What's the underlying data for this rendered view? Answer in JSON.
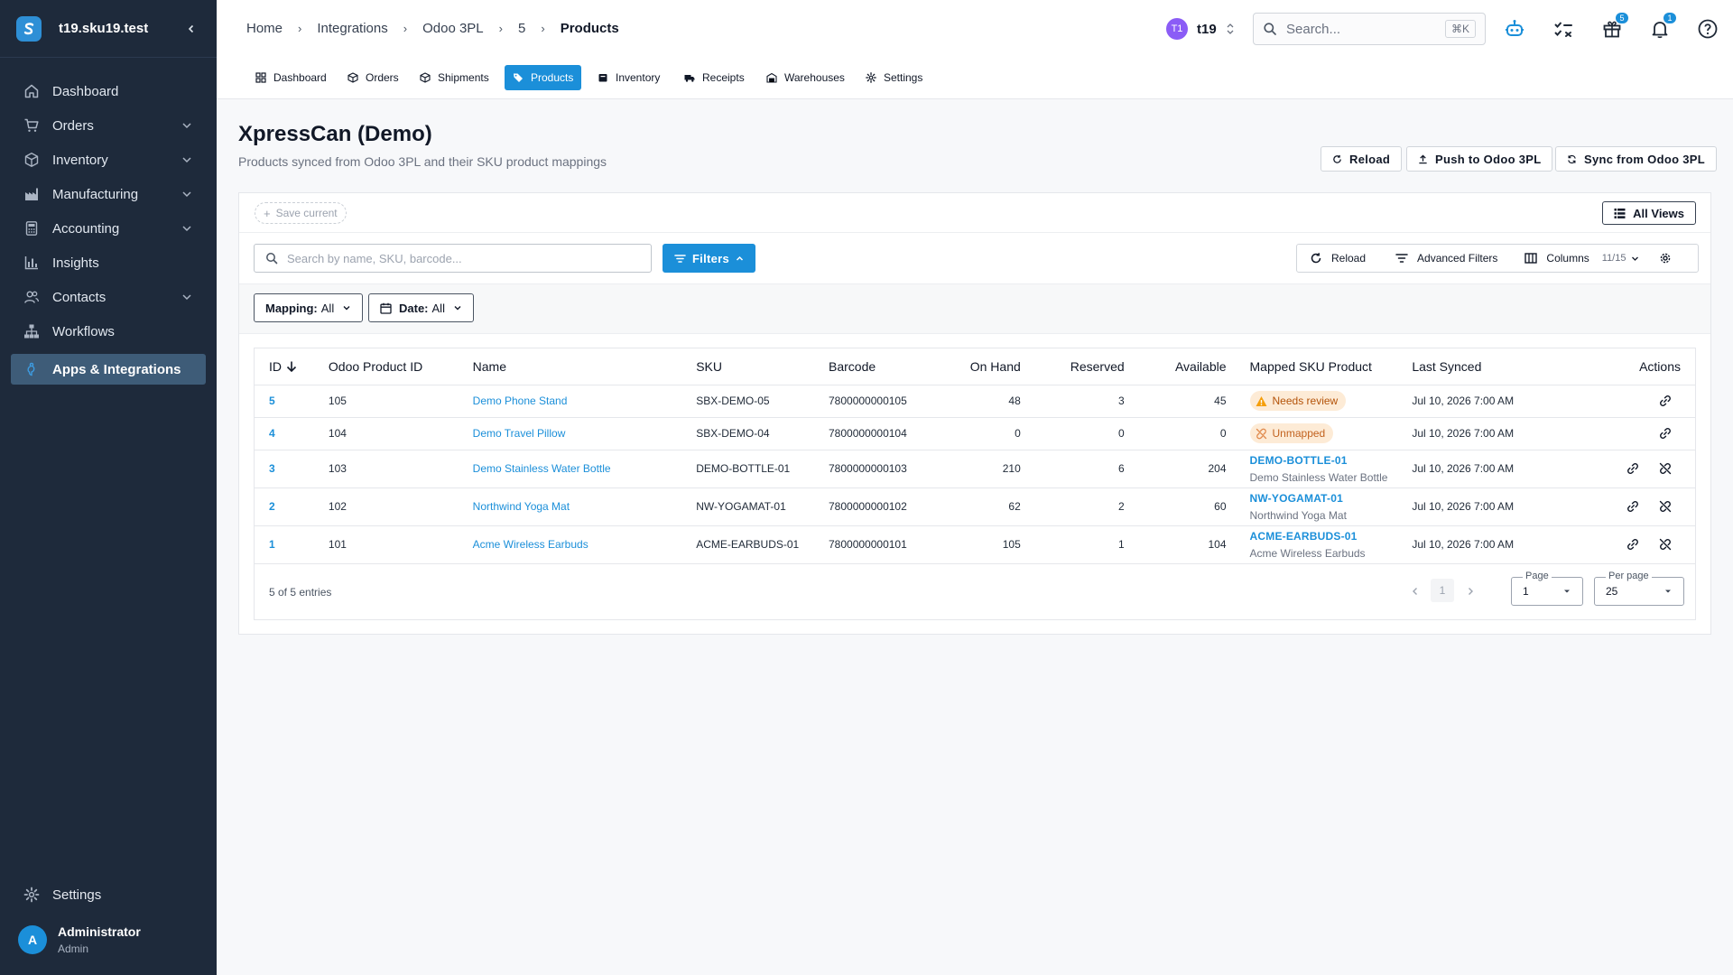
{
  "app": {
    "workspace": "t19.sku19.test"
  },
  "sidebar": {
    "items": [
      {
        "label": "Dashboard",
        "icon": "home-icon",
        "expandable": false
      },
      {
        "label": "Orders",
        "icon": "cart-icon",
        "expandable": true
      },
      {
        "label": "Inventory",
        "icon": "box-icon",
        "expandable": true
      },
      {
        "label": "Manufacturing",
        "icon": "factory-icon",
        "expandable": true
      },
      {
        "label": "Accounting",
        "icon": "calculator-icon",
        "expandable": true
      },
      {
        "label": "Insights",
        "icon": "bar-chart-icon",
        "expandable": false
      },
      {
        "label": "Contacts",
        "icon": "users-icon",
        "expandable": true
      },
      {
        "label": "Workflows",
        "icon": "sitemap-icon",
        "expandable": false
      },
      {
        "label": "Apps & Integrations",
        "icon": "puzzle-icon",
        "expandable": false,
        "active": true
      }
    ],
    "settings_label": "Settings",
    "user": {
      "initial": "A",
      "name": "Administrator",
      "role": "Admin"
    }
  },
  "topbar": {
    "breadcrumbs": [
      "Home",
      "Integrations",
      "Odoo 3PL",
      "5",
      "Products"
    ],
    "tenant": {
      "initials": "T1",
      "name": "t19"
    },
    "search": {
      "placeholder": "Search...",
      "shortcut": "⌘K"
    },
    "badges": {
      "gift": "5",
      "notifications": "1"
    }
  },
  "tabs": [
    {
      "label": "Dashboard",
      "icon": "dashboard-icon"
    },
    {
      "label": "Orders",
      "icon": "orders-icon"
    },
    {
      "label": "Shipments",
      "icon": "shipments-icon"
    },
    {
      "label": "Products",
      "icon": "tag-icon",
      "active": true
    },
    {
      "label": "Inventory",
      "icon": "inventory-icon"
    },
    {
      "label": "Receipts",
      "icon": "truck-icon"
    },
    {
      "label": "Warehouses",
      "icon": "warehouse-icon"
    },
    {
      "label": "Settings",
      "icon": "gear-icon"
    }
  ],
  "page": {
    "title": "XpressCan (Demo)",
    "subtitle": "Products synced from Odoo 3PL and their SKU product mappings",
    "actions": {
      "reload": "Reload",
      "push": "Push to Odoo 3PL",
      "sync": "Sync from Odoo 3PL"
    }
  },
  "toolbar": {
    "save_current": "Save current",
    "all_views": "All Views",
    "search_placeholder": "Search by name, SKU, barcode...",
    "filters": "Filters",
    "reload": "Reload",
    "advanced_filters": "Advanced Filters",
    "columns": "Columns",
    "columns_count": "11/15"
  },
  "filter_chips": {
    "mapping": {
      "label": "Mapping:",
      "value": "All"
    },
    "date": {
      "label": "Date:",
      "value": "All"
    }
  },
  "table": {
    "columns": [
      "ID",
      "Odoo Product ID",
      "Name",
      "SKU",
      "Barcode",
      "On Hand",
      "Reserved",
      "Available",
      "Mapped SKU Product",
      "Last Synced",
      "Actions"
    ],
    "rows": [
      {
        "id": "5",
        "odoo_id": "105",
        "name": "Demo Phone Stand",
        "sku": "SBX-DEMO-05",
        "barcode": "7800000000105",
        "on_hand": "48",
        "reserved": "3",
        "available": "45",
        "mapping_status": "Needs review",
        "last_synced": "Jul 10, 2026 7:00 AM"
      },
      {
        "id": "4",
        "odoo_id": "104",
        "name": "Demo Travel Pillow",
        "sku": "SBX-DEMO-04",
        "barcode": "7800000000104",
        "on_hand": "0",
        "reserved": "0",
        "available": "0",
        "mapping_status": "Unmapped",
        "last_synced": "Jul 10, 2026 7:00 AM"
      },
      {
        "id": "3",
        "odoo_id": "103",
        "name": "Demo Stainless Water Bottle",
        "sku": "DEMO-BOTTLE-01",
        "barcode": "7800000000103",
        "on_hand": "210",
        "reserved": "6",
        "available": "204",
        "mapped_sku": "DEMO-BOTTLE-01",
        "mapped_name": "Demo Stainless Water Bottle",
        "last_synced": "Jul 10, 2026 7:00 AM"
      },
      {
        "id": "2",
        "odoo_id": "102",
        "name": "Northwind Yoga Mat",
        "sku": "NW-YOGAMAT-01",
        "barcode": "7800000000102",
        "on_hand": "62",
        "reserved": "2",
        "available": "60",
        "mapped_sku": "NW-YOGAMAT-01",
        "mapped_name": "Northwind Yoga Mat",
        "last_synced": "Jul 10, 2026 7:00 AM"
      },
      {
        "id": "1",
        "odoo_id": "101",
        "name": "Acme Wireless Earbuds",
        "sku": "ACME-EARBUDS-01",
        "barcode": "7800000000101",
        "on_hand": "105",
        "reserved": "1",
        "available": "104",
        "mapped_sku": "ACME-EARBUDS-01",
        "mapped_name": "Acme Wireless Earbuds",
        "last_synced": "Jul 10, 2026 7:00 AM"
      }
    ]
  },
  "pagination": {
    "summary": "5 of 5 entries",
    "current_page": "1",
    "page_label": "Page",
    "page_value": "1",
    "per_page_label": "Per page",
    "per_page_value": "25"
  },
  "colors": {
    "accent": "#1b8fd9",
    "sidebar_bg": "#1e2a3b",
    "sidebar_active": "#3e5c78",
    "warning_bg": "#fdebd6",
    "warning_text": "#b45309"
  }
}
